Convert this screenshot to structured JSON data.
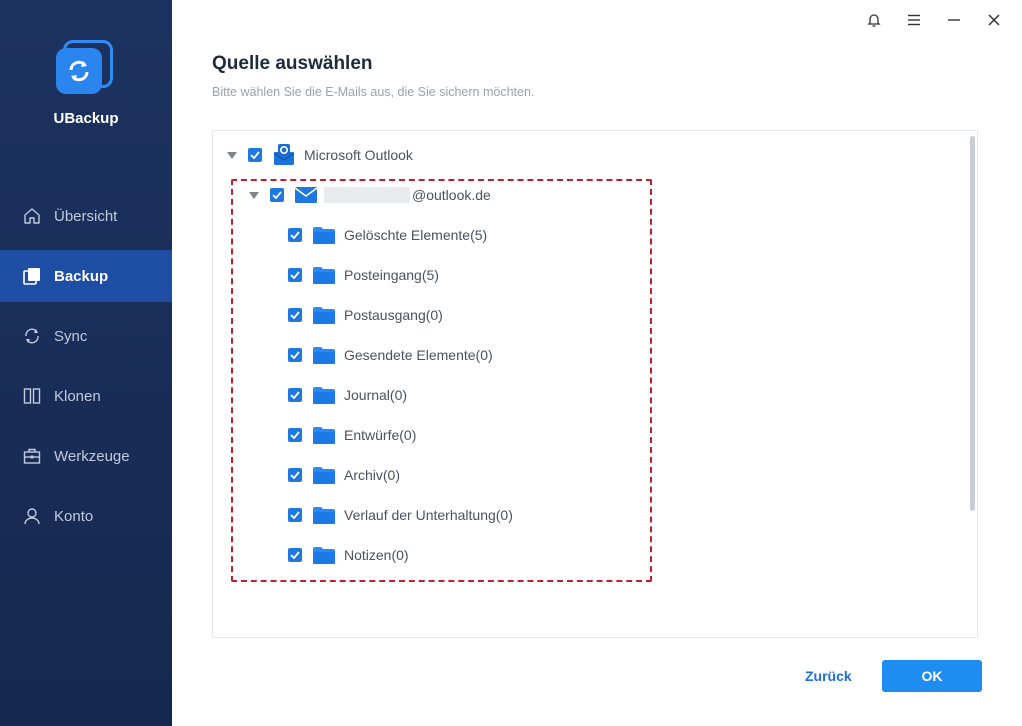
{
  "app": {
    "brand": "UBackup"
  },
  "sidebar": {
    "items": [
      {
        "label": "Übersicht",
        "icon": "home-icon",
        "active": false
      },
      {
        "label": "Backup",
        "icon": "backup-icon",
        "active": true
      },
      {
        "label": "Sync",
        "icon": "sync-icon",
        "active": false
      },
      {
        "label": "Klonen",
        "icon": "clone-icon",
        "active": false
      },
      {
        "label": "Werkzeuge",
        "icon": "toolbox-icon",
        "active": false
      },
      {
        "label": "Konto",
        "icon": "user-icon",
        "active": false
      }
    ]
  },
  "header": {
    "title": "Quelle auswählen",
    "subtitle": "Bitte wählen Sie die E-Mails aus, die Sie sichern möchten."
  },
  "tree": {
    "root": {
      "label": "Microsoft Outlook",
      "checked": true,
      "expanded": true,
      "icon": "outlook-icon"
    },
    "account": {
      "label": "@outlook.de",
      "checked": true,
      "expanded": true,
      "icon": "mail-icon"
    },
    "folders": [
      {
        "label": "Gelöschte Elemente(5)",
        "checked": true
      },
      {
        "label": "Posteingang(5)",
        "checked": true
      },
      {
        "label": "Postausgang(0)",
        "checked": true
      },
      {
        "label": "Gesendete Elemente(0)",
        "checked": true
      },
      {
        "label": "Journal(0)",
        "checked": true
      },
      {
        "label": "Entwürfe(0)",
        "checked": true
      },
      {
        "label": "Archiv(0)",
        "checked": true
      },
      {
        "label": "Verlauf der Unterhaltung(0)",
        "checked": true
      },
      {
        "label": "Notizen(0)",
        "checked": true
      }
    ]
  },
  "footer": {
    "back_label": "Zurück",
    "ok_label": "OK"
  },
  "colors": {
    "sidebar_bg": "#1c3260",
    "active_nav": "#1e4ea4",
    "accent": "#1e8cf0",
    "checkbox": "#1e78e0",
    "highlight_border": "#c0202a"
  }
}
